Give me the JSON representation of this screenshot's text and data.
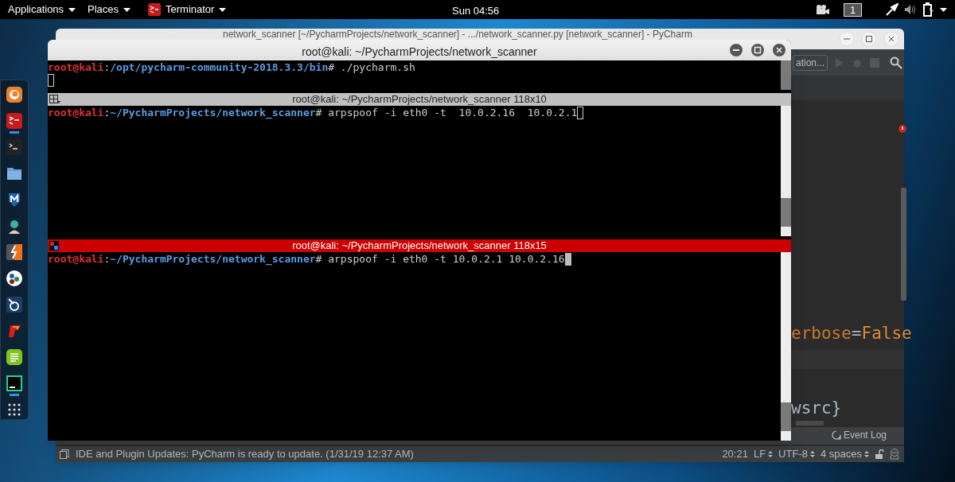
{
  "top_bar": {
    "menus": [
      {
        "label": "Applications",
        "kind": "plain"
      },
      {
        "label": "Places",
        "kind": "plain"
      },
      {
        "label": "Terminator",
        "kind": "app"
      }
    ],
    "clock": "Sun 04:56",
    "workspace": "1"
  },
  "dock": {
    "items": [
      {
        "kind": "browser",
        "running": false
      },
      {
        "kind": "terminator",
        "running": true
      },
      {
        "kind": "terminal",
        "running": false
      },
      {
        "kind": "folder",
        "running": false
      },
      {
        "kind": "shield",
        "running": false
      },
      {
        "kind": "avatar",
        "running": false
      },
      {
        "kind": "bolt",
        "running": false
      },
      {
        "kind": "dots",
        "running": false
      },
      {
        "kind": "cyclone",
        "running": false
      },
      {
        "kind": "flame",
        "running": false
      },
      {
        "kind": "notes",
        "running": false
      },
      {
        "kind": "ide",
        "running": true
      },
      {
        "kind": "grid",
        "running": false
      }
    ]
  },
  "ide": {
    "title": "network_scanner [~/PycharmProjects/network_scanner] - .../network_scanner.py [network_scanner] - PyCharm",
    "run_config": "ation...",
    "code": [
      {
        "parts": [
          {
            "text": "erbose",
            "kind": "param"
          },
          {
            "text": "=",
            "kind": "op"
          },
          {
            "text": "False",
            "kind": "keyword"
          }
        ]
      },
      {
        "parts": [
          {
            "text": "wsrc}",
            "kind": "plain"
          }
        ]
      }
    ],
    "event_log": "Event Log",
    "status": {
      "message": "IDE and Plugin Updates: PyCharm is ready to update. (1/31/19 12:37 AM)",
      "position": "20:21",
      "line_ending": "LF",
      "encoding": "UTF-8",
      "indent": "4 spaces"
    }
  },
  "terminal": {
    "title": "root@kali: ~/PycharmProjects/network_scanner",
    "panes": [
      {
        "focused": false,
        "lines": [
          {
            "user": "root@kali",
            "separator": ":",
            "path": "/opt/pycharm-community-2018.3.3/bin",
            "symbol": "#",
            "command": " ./pycharm.sh",
            "cursor": false
          },
          {
            "cursor": true
          }
        ]
      },
      {
        "title": "root@kali: ~/PycharmProjects/network_scanner 118x10",
        "focused": false,
        "lines": [
          {
            "user": "root@kali",
            "separator": ":",
            "path": "~/PycharmProjects/network_scanner",
            "symbol": "#",
            "command": " arpspoof -i eth0 -t  10.0.2.16  10.0.2.1",
            "cursor": true
          }
        ]
      },
      {
        "title": "root@kali: ~/PycharmProjects/network_scanner 118x15",
        "focused": true,
        "lines": [
          {
            "user": "root@kali",
            "separator": ":",
            "path": "~/PycharmProjects/network_scanner",
            "symbol": "#",
            "command": " arpspoof -i eth0 -t 10.0.2.1 10.0.2.16",
            "cursor": true
          }
        ]
      }
    ]
  }
}
